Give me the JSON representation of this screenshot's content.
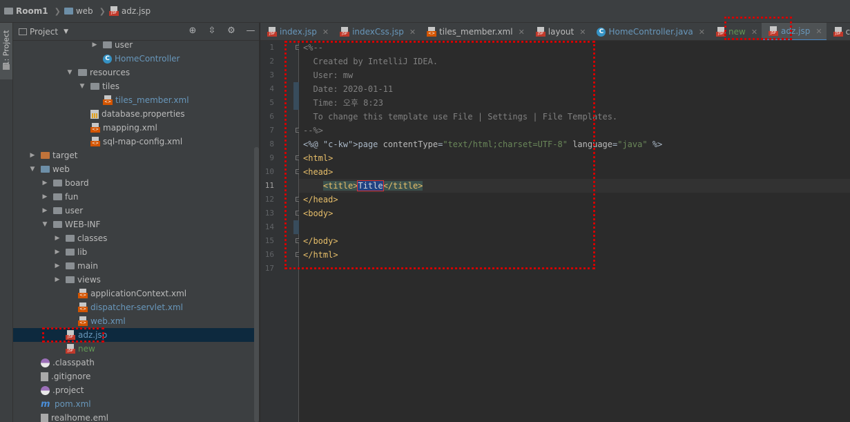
{
  "breadcrumb": [
    "Room1",
    "web",
    "adz.jsp"
  ],
  "side_tool": {
    "label": "1: Project"
  },
  "project_panel": {
    "title": "Project",
    "header_icons": [
      "target-icon",
      "collapse-icon",
      "gear-icon",
      "minimize-icon"
    ]
  },
  "tree": [
    {
      "label": "user",
      "icon": "folder",
      "expanded": false,
      "color": "normal"
    },
    {
      "label": "HomeController",
      "icon": "java-class",
      "color": "blue"
    },
    {
      "label": "resources",
      "icon": "resources-folder",
      "expanded": true,
      "color": "normal"
    },
    {
      "label": "tiles",
      "icon": "folder",
      "expanded": true,
      "color": "normal"
    },
    {
      "label": "tiles_member.xml",
      "icon": "xml",
      "color": "blue"
    },
    {
      "label": "database.properties",
      "icon": "properties",
      "color": "normal"
    },
    {
      "label": "mapping.xml",
      "icon": "xml",
      "color": "normal"
    },
    {
      "label": "sql-map-config.xml",
      "icon": "xml",
      "color": "normal"
    },
    {
      "label": "target",
      "icon": "folder-orange",
      "expanded": false,
      "color": "normal"
    },
    {
      "label": "web",
      "icon": "web-folder",
      "expanded": true,
      "color": "normal"
    },
    {
      "label": "board",
      "icon": "folder",
      "expanded": false,
      "color": "normal"
    },
    {
      "label": "fun",
      "icon": "folder",
      "expanded": false,
      "color": "normal"
    },
    {
      "label": "user",
      "icon": "folder",
      "expanded": false,
      "color": "normal"
    },
    {
      "label": "WEB-INF",
      "icon": "folder",
      "expanded": true,
      "color": "normal"
    },
    {
      "label": "classes",
      "icon": "folder",
      "expanded": false,
      "color": "normal"
    },
    {
      "label": "lib",
      "icon": "folder",
      "expanded": false,
      "color": "normal"
    },
    {
      "label": "main",
      "icon": "folder",
      "expanded": false,
      "color": "normal"
    },
    {
      "label": "views",
      "icon": "folder",
      "expanded": false,
      "color": "normal"
    },
    {
      "label": "applicationContext.xml",
      "icon": "spring-xml",
      "color": "normal"
    },
    {
      "label": "dispatcher-servlet.xml",
      "icon": "spring-xml",
      "color": "blue"
    },
    {
      "label": "web.xml",
      "icon": "web-xml",
      "color": "blue"
    },
    {
      "label": "adz.jsp",
      "icon": "jsp",
      "color": "blue",
      "selected": true
    },
    {
      "label": "new",
      "icon": "jsp",
      "color": "green"
    },
    {
      "label": ".classpath",
      "icon": "classpath",
      "color": "normal"
    },
    {
      "label": ".gitignore",
      "icon": "file",
      "color": "normal"
    },
    {
      "label": ".project",
      "icon": "classpath",
      "color": "normal"
    },
    {
      "label": "pom.xml",
      "icon": "maven",
      "color": "blue"
    },
    {
      "label": "realhome.eml",
      "icon": "file",
      "color": "normal"
    }
  ],
  "tabs": [
    {
      "label": "index.jsp",
      "icon": "jsp",
      "color": "blue"
    },
    {
      "label": "indexCss.jsp",
      "icon": "jsp",
      "color": "blue"
    },
    {
      "label": "tiles_member.xml",
      "icon": "xml",
      "color": "normal"
    },
    {
      "label": "layout",
      "icon": "jsp",
      "color": "normal"
    },
    {
      "label": "HomeController.java",
      "icon": "java-class",
      "color": "blue"
    },
    {
      "label": "new",
      "icon": "jsp",
      "color": "green"
    },
    {
      "label": "adz.jsp",
      "icon": "jsp",
      "color": "blue",
      "active": true
    },
    {
      "label": "css.jsp",
      "icon": "jsp",
      "color": "normal"
    }
  ],
  "editor": {
    "current_line": 11,
    "line_numbers": [
      "1",
      "2",
      "3",
      "4",
      "5",
      "6",
      "7",
      "8",
      "9",
      "10",
      "11",
      "12",
      "13",
      "14",
      "15",
      "16",
      "17"
    ],
    "lines": [
      "<%--",
      "  Created by IntelliJ IDEA.",
      "  User: mw",
      "  Date: 2020-01-11",
      "  Time: 오후 8:23",
      "  To change this template use File | Settings | File Templates.",
      "--%>",
      "<%@ page contentType=\"text/html;charset=UTF-8\" language=\"java\" %>",
      "<html>",
      "<head>",
      "    <title>Title</title>",
      "</head>",
      "<body>",
      "",
      "</body>",
      "</html>",
      ""
    ]
  },
  "colors": {
    "highlight_box": "#d20000",
    "accent": "#4a88c7",
    "background": "#2b2b2b"
  }
}
